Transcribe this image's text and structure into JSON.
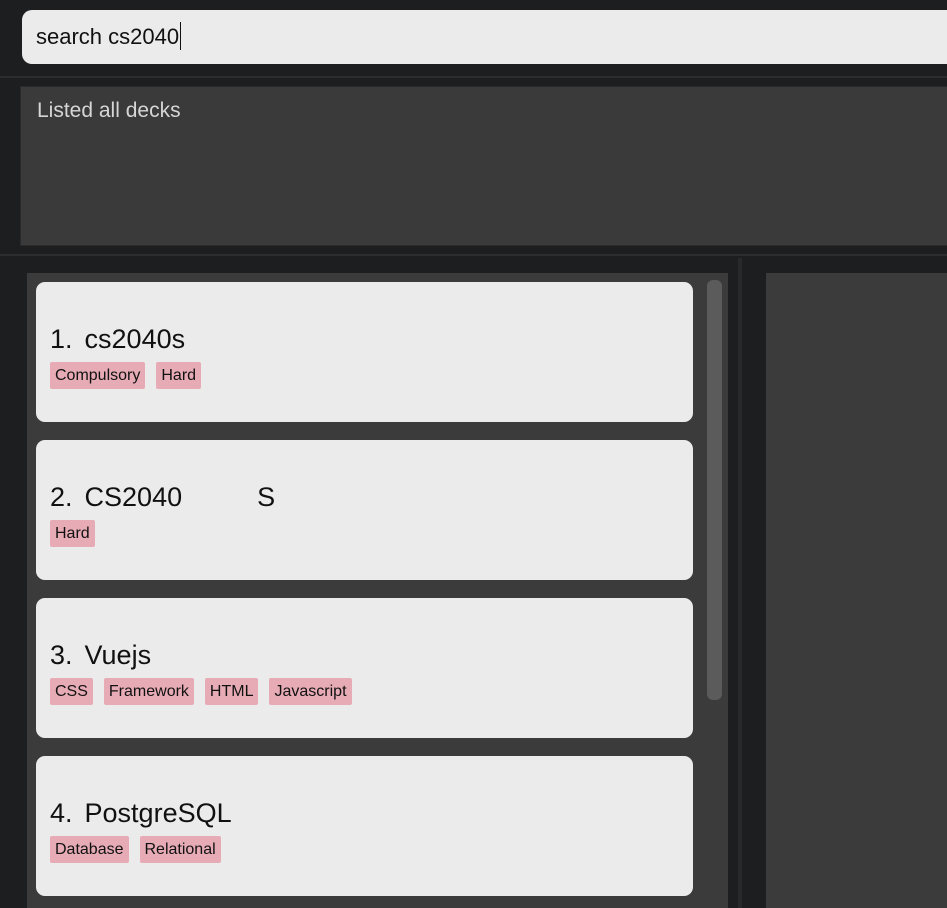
{
  "command": {
    "value": "search cs2040"
  },
  "result": {
    "text": "Listed all decks"
  },
  "decks": [
    {
      "index": "1.",
      "name": "cs2040s",
      "tags": [
        "Compulsory",
        "Hard"
      ]
    },
    {
      "index": "2.",
      "name": "CS2040          S",
      "tags": [
        "Hard"
      ]
    },
    {
      "index": "3.",
      "name": "Vuejs",
      "tags": [
        "CSS",
        "Framework",
        "HTML",
        "Javascript"
      ]
    },
    {
      "index": "4.",
      "name": "PostgreSQL",
      "tags": [
        "Database",
        "Relational"
      ]
    }
  ]
}
